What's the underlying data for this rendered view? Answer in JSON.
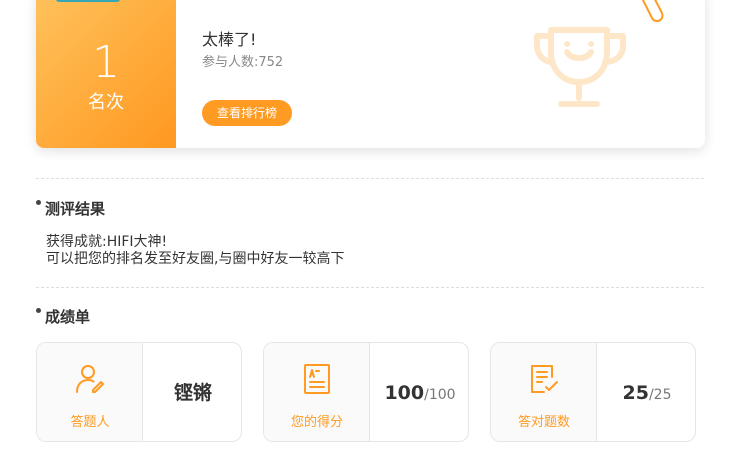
{
  "rank": {
    "position": "1",
    "unit": "名次",
    "message": "太棒了!",
    "participants_label": "参与人数:",
    "participants_count": "752",
    "leaderboard_button": "查看排行榜"
  },
  "results": {
    "title": "测评结果",
    "line1": "获得成就:HIFI大神!",
    "line2": "可以把您的排名发至好友圈,与圈中好友一较高下"
  },
  "report": {
    "title": "成绩单",
    "cards": [
      {
        "icon": "user-edit-icon",
        "label": "答题人",
        "value": "铿锵",
        "max": ""
      },
      {
        "icon": "score-sheet-icon",
        "label": "您的得分",
        "value": "100",
        "max": "/100"
      },
      {
        "icon": "checklist-icon",
        "label": "答对题数",
        "value": "25",
        "max": "/25"
      }
    ]
  },
  "colors": {
    "accent": "#ff9b22",
    "gradient_start": "#ffc25c",
    "gradient_end": "#ff9820",
    "tab": "#37a6b5"
  }
}
